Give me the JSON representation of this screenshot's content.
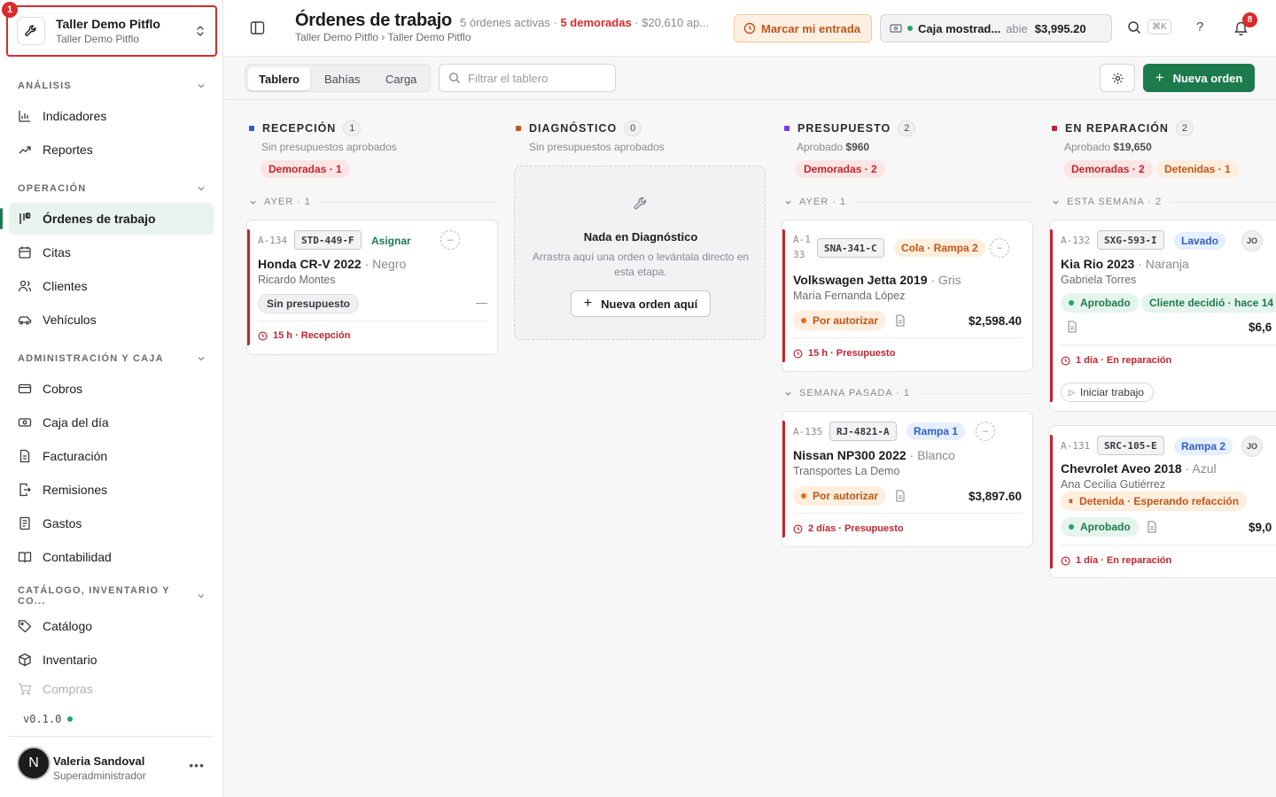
{
  "workspace": {
    "badge": "1",
    "title": "Taller Demo Pitflo",
    "subtitle": "Taller Demo Pitflo"
  },
  "sidebar": {
    "sections": [
      {
        "label": "ANÁLISIS",
        "items": [
          "Indicadores",
          "Reportes"
        ]
      },
      {
        "label": "OPERACIÓN",
        "items": [
          "Órdenes de trabajo",
          "Citas",
          "Clientes",
          "Vehículos"
        ]
      },
      {
        "label": "ADMINISTRACIÓN Y CAJA",
        "items": [
          "Cobros",
          "Caja del día",
          "Facturación",
          "Remisiones",
          "Gastos",
          "Contabilidad"
        ]
      },
      {
        "label": "CATÁLOGO, INVENTARIO Y CO...",
        "items": [
          "Catálogo",
          "Inventario",
          "Compras"
        ]
      }
    ],
    "active": "Órdenes de trabajo",
    "version": "v0.1.0",
    "user": {
      "initial": "N",
      "name": "Valeria Sandoval",
      "role": "Superadministrador"
    }
  },
  "header": {
    "title": "Órdenes de trabajo",
    "meta_active": "5 órdenes activas ·",
    "meta_late": "5 demoradas",
    "meta_tail": "· $20,610 ap...",
    "breadcrumb": "Taller Demo Pitflo › Taller Demo Pitflo",
    "clockin_label": "Marcar mi entrada",
    "register": {
      "name": "Caja mostrad...",
      "status": "abie",
      "amount": "$3,995.20"
    },
    "shortcut": "⌘K",
    "help": "?",
    "notifications": "8"
  },
  "toolbar": {
    "tabs": [
      "Tablero",
      "Bahías",
      "Carga"
    ],
    "selected_tab": "Tablero",
    "filter_placeholder": "Filtrar el tablero",
    "new_order_label": "Nueva orden"
  },
  "colors": {
    "accent": "#1d7a4c",
    "danger": "#c0262d",
    "warning": "#c2561a",
    "info": "#2f62c9"
  },
  "columns": [
    {
      "name": "RECEPCIÓN",
      "count": "1",
      "color": "#2f62c9",
      "subtitle": "Sin presupuestos aprobados",
      "pills": [
        {
          "label": "Demoradas · 1",
          "kind": "red"
        }
      ],
      "groups": [
        {
          "label": "AYER · 1",
          "cards": [
            {
              "id": "A-134",
              "plate": "STD-449-F",
              "assign": "Asignar",
              "car": "Honda CR-V 2022",
              "color": "· Negro",
              "customer": "Ricardo Montes",
              "status": "Sin presupuesto",
              "status_aux": "—",
              "time": "15 h · Recepción"
            }
          ]
        }
      ]
    },
    {
      "name": "DIAGNÓSTICO",
      "count": "0",
      "color": "#c2561a",
      "subtitle": "Sin presupuestos aprobados",
      "empty": {
        "title": "Nada en Diagnóstico",
        "desc": "Arrastra aquí una orden o levántala directo en esta etapa.",
        "button": "Nueva orden aquí"
      }
    },
    {
      "name": "PRESUPUESTO",
      "count": "2",
      "color": "#7c3aed",
      "subtitle_prefix": "Aprobado",
      "subtitle_value": "$960",
      "pills": [
        {
          "label": "Demoradas · 2",
          "kind": "red"
        }
      ],
      "groups": [
        {
          "label": "AYER · 1",
          "cards": [
            {
              "id": "A-133",
              "plate": "SNA-341-C",
              "tag": "Cola · Rampa 2",
              "car": "Volkswagen Jetta 2019",
              "color": "· Gris",
              "customer": "María Fernanda López",
              "status": "Por autorizar",
              "amount": "$2,598.40",
              "time": "15 h · Presupuesto"
            }
          ]
        },
        {
          "label": "SEMANA PASADA · 1",
          "cards": [
            {
              "id": "A-135",
              "plate": "RJ-4821-A",
              "tag": "Rampa 1",
              "car": "Nissan NP300 2022",
              "color": "· Blanco",
              "customer": "Transportes La Demo",
              "status": "Por autorizar",
              "amount": "$3,897.60",
              "time": "2 días · Presupuesto"
            }
          ]
        }
      ]
    },
    {
      "name": "EN REPARACIÓN",
      "count": "2",
      "color": "#c0262d",
      "subtitle_prefix": "Aprobado",
      "subtitle_value": "$19,650",
      "pills": [
        {
          "label": "Demoradas · 2",
          "kind": "red"
        },
        {
          "label": "Detenidas · 1",
          "kind": "orange"
        }
      ],
      "groups": [
        {
          "label": "ESTA SEMANA · 2",
          "cards": [
            {
              "id": "A-132",
              "plate": "SXG-593-I",
              "tag": "Lavado",
              "avatar": "JO",
              "car": "Kia Rio 2023",
              "color": "· Naranja",
              "customer": "Gabriela Torres",
              "status": "Aprobado",
              "status2": "Cliente decidió · hace 14",
              "amount": "$6,6",
              "time": "1 día · En reparación",
              "action": "Iniciar trabajo"
            },
            {
              "id": "A-131",
              "plate": "SRC-105-E",
              "tag": "Rampa 2",
              "avatar": "JO",
              "car": "Chevrolet Aveo 2018",
              "color": "· Azul",
              "customer": "Ana Cecilia Gutiérrez",
              "hold": "Detenida · Esperando refacción",
              "status": "Aprobado",
              "amount": "$9,0",
              "time": "1 día · En reparación"
            }
          ]
        }
      ]
    }
  ]
}
